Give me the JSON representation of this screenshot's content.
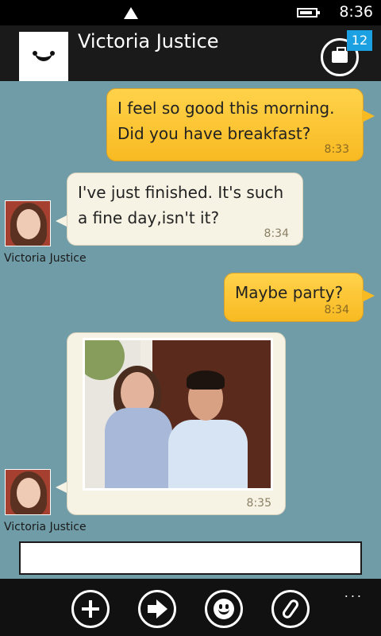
{
  "status_bar": {
    "time": "8:36"
  },
  "header": {
    "title": "Victoria Justice",
    "badge_count": "12"
  },
  "messages": [
    {
      "direction": "out",
      "lines": [
        "I feel so good this morning.",
        "Did you have breakfast?"
      ],
      "time": "8:33"
    },
    {
      "direction": "in",
      "lines": [
        "I've just finished. It's such",
        "a fine day,isn't it?"
      ],
      "time": "8:34",
      "sender": "Victoria Justice"
    },
    {
      "direction": "out",
      "lines": [
        "Maybe party?"
      ],
      "time": "8:34"
    },
    {
      "direction": "in",
      "type": "photo",
      "time": "8:35",
      "sender": "Victoria Justice"
    }
  ],
  "composer": {
    "value": "",
    "placeholder": ""
  },
  "app_bar": {
    "buttons": [
      "add-icon",
      "send-arrow-icon",
      "emoji-icon",
      "attach-icon"
    ],
    "more": "..."
  },
  "colors": {
    "background": "#6f9ca7",
    "outgoing": "#f8ba22",
    "incoming": "#f7f3e4",
    "badge": "#1ba1e2"
  }
}
